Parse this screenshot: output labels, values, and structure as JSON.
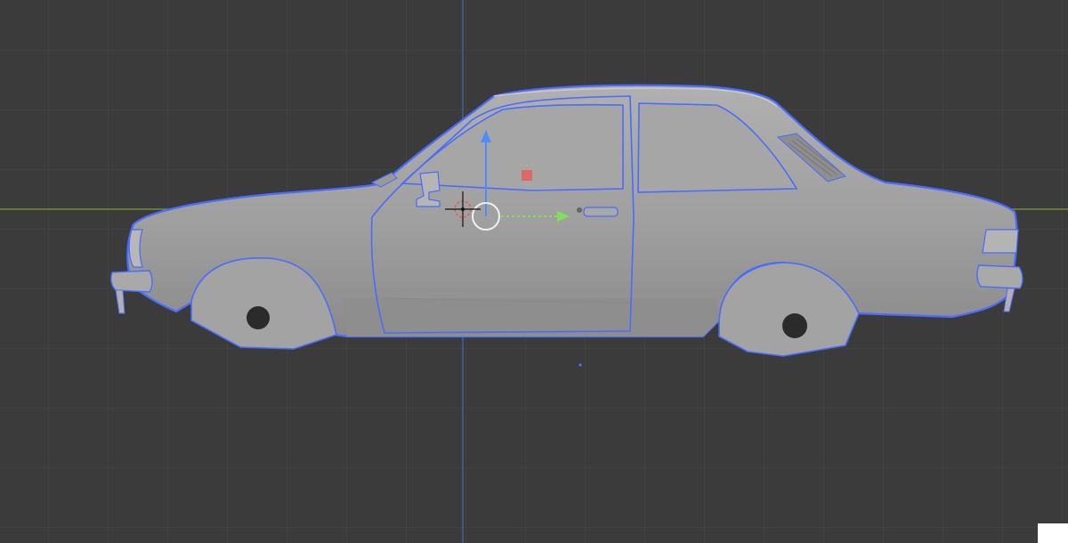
{
  "viewport": {
    "view": "side-orthographic",
    "background_color": "#3b3b3b",
    "grid_color": "#474747",
    "x_axis_color": "#7e9a3a",
    "z_axis_color": "#3e6bb3",
    "selection_outline_color": "#4a6bff"
  },
  "scene": {
    "object": "car-body",
    "object_color": "#9f9f9f",
    "selected": true
  },
  "gizmo": {
    "up_arrow_color": "#4d8bff",
    "right_arrow_color": "#7fe05a",
    "center_handle_color": "#e75a5a"
  },
  "icons": [
    "3d-cursor-icon",
    "transform-gizmo-icon"
  ]
}
